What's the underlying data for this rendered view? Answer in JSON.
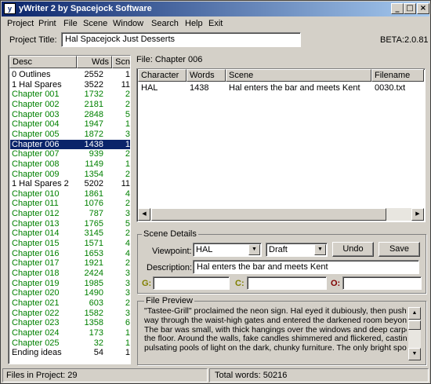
{
  "window": {
    "title": "yWriter 2 by Spacejock Software",
    "minimize": "_",
    "maximize": "□",
    "close": "×"
  },
  "menu": [
    "Project",
    "Print",
    "File",
    "Scene",
    "Window",
    "Search",
    "Help",
    "Exit"
  ],
  "project": {
    "title_label": "Project Title:",
    "title_value": "Hal Spacejock Just Desserts",
    "version": "BETA:2.0.81"
  },
  "chapter_list": {
    "headers": [
      "Desc",
      "Wds",
      "Scn"
    ],
    "rows": [
      {
        "desc": "0 Outlines",
        "wds": "2552",
        "scn": "1",
        "green": false
      },
      {
        "desc": "1 Hal Spares",
        "wds": "3522",
        "scn": "11",
        "green": false
      },
      {
        "desc": "Chapter 001",
        "wds": "1732",
        "scn": "2",
        "green": true
      },
      {
        "desc": "Chapter 002",
        "wds": "2181",
        "scn": "2",
        "green": true
      },
      {
        "desc": "Chapter 003",
        "wds": "2848",
        "scn": "5",
        "green": true
      },
      {
        "desc": "Chapter 004",
        "wds": "1947",
        "scn": "1",
        "green": true
      },
      {
        "desc": "Chapter 005",
        "wds": "1872",
        "scn": "3",
        "green": true
      },
      {
        "desc": "Chapter 006",
        "wds": "1438",
        "scn": "1",
        "green": true,
        "selected": true
      },
      {
        "desc": "Chapter 007",
        "wds": "939",
        "scn": "2",
        "green": true
      },
      {
        "desc": "Chapter 008",
        "wds": "1149",
        "scn": "1",
        "green": true
      },
      {
        "desc": "Chapter 009",
        "wds": "1354",
        "scn": "2",
        "green": true
      },
      {
        "desc": "1 Hal Spares 2",
        "wds": "5202",
        "scn": "11",
        "green": false
      },
      {
        "desc": "Chapter 010",
        "wds": "1861",
        "scn": "4",
        "green": true
      },
      {
        "desc": "Chapter 011",
        "wds": "1076",
        "scn": "2",
        "green": true
      },
      {
        "desc": "Chapter 012",
        "wds": "787",
        "scn": "3",
        "green": true
      },
      {
        "desc": "Chapter 013",
        "wds": "1765",
        "scn": "5",
        "green": true
      },
      {
        "desc": "Chapter 014",
        "wds": "3145",
        "scn": "2",
        "green": true
      },
      {
        "desc": "Chapter 015",
        "wds": "1571",
        "scn": "4",
        "green": true
      },
      {
        "desc": "Chapter 016",
        "wds": "1653",
        "scn": "4",
        "green": true
      },
      {
        "desc": "Chapter 017",
        "wds": "1921",
        "scn": "2",
        "green": true
      },
      {
        "desc": "Chapter 018",
        "wds": "2424",
        "scn": "3",
        "green": true
      },
      {
        "desc": "Chapter 019",
        "wds": "1985",
        "scn": "3",
        "green": true
      },
      {
        "desc": "Chapter 020",
        "wds": "1490",
        "scn": "3",
        "green": true
      },
      {
        "desc": "Chapter 021",
        "wds": "603",
        "scn": "2",
        "green": true
      },
      {
        "desc": "Chapter 022",
        "wds": "1582",
        "scn": "3",
        "green": true
      },
      {
        "desc": "Chapter 023",
        "wds": "1358",
        "scn": "6",
        "green": true
      },
      {
        "desc": "Chapter 024",
        "wds": "173",
        "scn": "1",
        "green": true
      },
      {
        "desc": "Chapter 025",
        "wds": "32",
        "scn": "1",
        "green": true
      },
      {
        "desc": "Ending ideas",
        "wds": "54",
        "scn": "1",
        "green": false
      }
    ]
  },
  "file_label": "File: Chapter 006",
  "scene_table": {
    "headers": [
      "Character",
      "Words",
      "Scene",
      "Filename"
    ],
    "rows": [
      {
        "character": "HAL",
        "words": "1438",
        "scene": "Hal enters the bar and meets Kent",
        "filename": "0030.txt"
      }
    ]
  },
  "scene_details": {
    "group_title": "Scene Details",
    "viewpoint_label": "Viewpoint:",
    "viewpoint_value": "HAL",
    "status_value": "Draft",
    "undo_label": "Undo",
    "save_label": "Save",
    "description_label": "Description:",
    "description_value": "Hal enters the bar and meets Kent",
    "g_label": "G:",
    "c_label": "C:",
    "o_label": "O:",
    "g_value": "",
    "c_value": "",
    "o_value": ""
  },
  "file_preview": {
    "group_title": "File Preview",
    "lines": [
      "\"Tastee-Grill\" proclaimed the neon sign. Hal eyed it dubiously, then pushed his",
      "way through the waist-high gates and entered the darkened room beyond.",
      "The bar was small, with thick hangings over the windows and deep carpet on",
      "the floor. Around the walls, fake candles shimmered and flickered, casting",
      "pulsating pools of light on the dark, chunky furniture. The only bright spot was"
    ]
  },
  "status": {
    "files_in_project": "Files in Project: 29",
    "total_words": "Total words: 50216"
  },
  "colors": {
    "title_bar": "#0a246a",
    "selection": "#0a246a",
    "chapter_green": "#008000",
    "gc_label": "#808000",
    "o_label": "#800000"
  }
}
